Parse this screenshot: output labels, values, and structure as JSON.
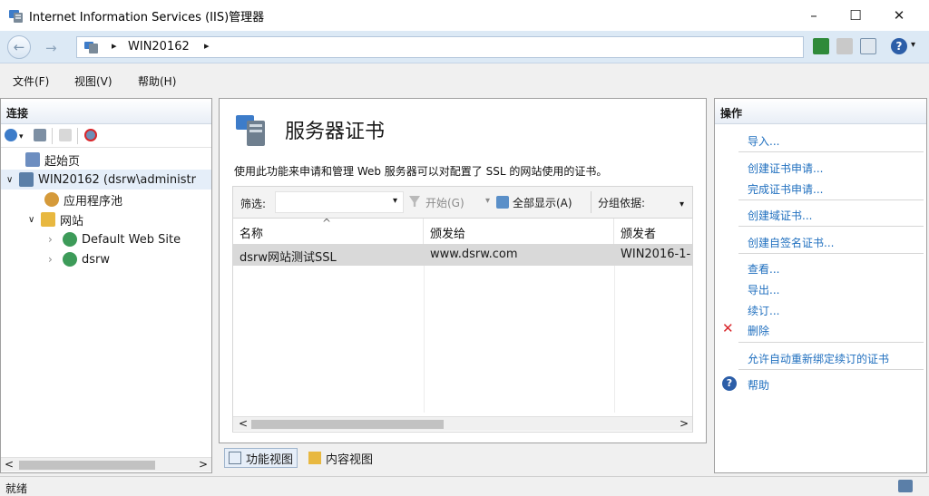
{
  "window": {
    "title": "Internet Information Services (IIS)管理器",
    "controls": {
      "minimize": "–",
      "maximize": "☐",
      "close": "✕"
    }
  },
  "addressbar": {
    "back_glyph": "←",
    "forward_glyph": "→",
    "crumb_sep": "▸",
    "crumb": "WIN20162",
    "crumb_trailing": "▸",
    "help_glyph": "?",
    "dropdown_glyph": "▾"
  },
  "menu": {
    "file": "文件(F)",
    "view": "视图(V)",
    "help": "帮助(H)"
  },
  "connections": {
    "header": "连接",
    "tree": [
      {
        "label": "起始页"
      },
      {
        "label": "WIN20162 (dsrw\\administr",
        "toggle": "∨"
      },
      {
        "label": "应用程序池"
      },
      {
        "label": "网站",
        "toggle": "∨"
      },
      {
        "label": "Default Web Site",
        "toggle": "›"
      },
      {
        "label": "dsrw",
        "toggle": "›"
      }
    ],
    "scroll_left": "<",
    "scroll_right": ">"
  },
  "feature": {
    "title": "服务器证书",
    "description": "使用此功能来申请和管理 Web 服务器可以对配置了 SSL 的网站使用的证书。",
    "filter": {
      "label": "筛选:",
      "go": "开始(G)",
      "show_all": "全部显示(A)",
      "group_by": "分组依据:",
      "dropdown_glyph": "▾"
    },
    "columns": [
      "名称",
      "颁发给",
      "颁发者"
    ],
    "sort_glyph": "^",
    "rows": [
      {
        "name": "dsrw网站测试SSL",
        "issued_to": "www.dsrw.com",
        "issued_by": "WIN2016-1-"
      }
    ],
    "scroll_left": "<",
    "scroll_right": ">"
  },
  "views": {
    "features": "功能视图",
    "content": "内容视图"
  },
  "actions": {
    "header": "操作",
    "items": [
      "导入...",
      "创建证书申请...",
      "完成证书申请...",
      "创建域证书...",
      "创建自签名证书...",
      "查看...",
      "导出...",
      "续订...",
      "删除",
      "允许自动重新绑定续订的证书",
      "帮助"
    ],
    "delete_glyph": "✕",
    "help_glyph": "?"
  },
  "status": {
    "text": "就绪"
  },
  "colors": {
    "link": "#1f6fbf",
    "selected_row": "#d9d9d9",
    "addressbar": "#dce9f5",
    "delete_red": "#d9262b"
  }
}
